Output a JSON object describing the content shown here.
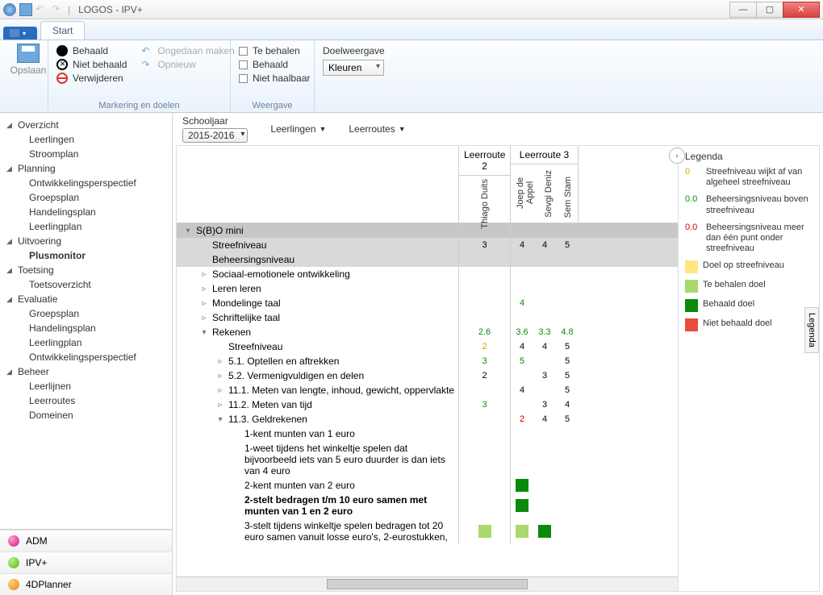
{
  "window": {
    "title": "LOGOS - IPV+"
  },
  "ribbon": {
    "tab": "Start",
    "save": "Opslaan",
    "mark": {
      "behaald": "Behaald",
      "niet_behaald": "Niet behaald",
      "verwijderen": "Verwijderen",
      "ongedaan": "Ongedaan maken",
      "opnieuw": "Opnieuw",
      "group": "Markering en doelen"
    },
    "weergave": {
      "te_behalen": "Te behalen",
      "behaald": "Behaald",
      "niet_haalbaar": "Niet haalbaar",
      "group": "Weergave"
    },
    "doel": {
      "label": "Doelweergave",
      "value": "Kleuren"
    }
  },
  "nav": {
    "groups": [
      {
        "label": "Overzicht",
        "items": [
          "Leerlingen",
          "Stroomplan"
        ]
      },
      {
        "label": "Planning",
        "items": [
          "Ontwikkelingsperspectief",
          "Groepsplan",
          "Handelingsplan",
          "Leerlingplan"
        ]
      },
      {
        "label": "Uitvoering",
        "items": [
          "Plusmonitor"
        ],
        "active": 0
      },
      {
        "label": "Toetsing",
        "items": [
          "Toetsoverzicht"
        ]
      },
      {
        "label": "Evaluatie",
        "items": [
          "Groepsplan",
          "Handelingsplan",
          "Leerlingplan",
          "Ontwikkelingsperspectief"
        ]
      },
      {
        "label": "Beheer",
        "items": [
          "Leerlijnen",
          "Leerroutes",
          "Domeinen"
        ]
      }
    ],
    "bottom": [
      "ADM",
      "IPV+",
      "4DPlanner"
    ]
  },
  "filter": {
    "schooljaar_label": "Schooljaar",
    "schooljaar": "2015-2016",
    "leerlingen": "Leerlingen",
    "leerroutes": "Leerroutes"
  },
  "grid": {
    "routes": [
      {
        "title": "Leerroute 2",
        "students": [
          "Thiago Duits"
        ]
      },
      {
        "title": "Leerroute 3",
        "students": [
          "Joep de Appel",
          "Sevgi Deniz",
          "Sem Stam"
        ]
      }
    ],
    "rows": [
      {
        "t": "hdr",
        "ind": 0,
        "tw": "▾",
        "label": "S(B)O mini"
      },
      {
        "t": "sub",
        "ind": 1,
        "label": "Streefniveau",
        "v": {
          "r2": "3",
          "r3": [
            "4",
            "4",
            "5"
          ]
        }
      },
      {
        "t": "sub",
        "ind": 1,
        "label": "Beheersingsniveau"
      },
      {
        "t": "row",
        "ind": 1,
        "tw": "▹",
        "label": "Sociaal-emotionele ontwikkeling"
      },
      {
        "t": "row",
        "ind": 1,
        "tw": "▹",
        "label": "Leren leren"
      },
      {
        "t": "row",
        "ind": 1,
        "tw": "▹",
        "label": "Mondelinge taal",
        "v": {
          "r3": [
            "4",
            "",
            ""
          ]
        },
        "cls": {
          "r3": [
            "green",
            "",
            ""
          ]
        }
      },
      {
        "t": "row",
        "ind": 1,
        "tw": "▹",
        "label": "Schriftelijke taal"
      },
      {
        "t": "row",
        "ind": 1,
        "tw": "▾",
        "label": "Rekenen",
        "v": {
          "r2": "2.6",
          "r3": [
            "3.6",
            "3.3",
            "4.8"
          ]
        },
        "cls": {
          "r2": "green",
          "r3": [
            "green",
            "green",
            "green"
          ]
        }
      },
      {
        "t": "row",
        "ind": 2,
        "label": "Streefniveau",
        "v": {
          "r2": "2",
          "r3": [
            "4",
            "4",
            "5"
          ]
        },
        "cls": {
          "r2": "orange"
        }
      },
      {
        "t": "row",
        "ind": 2,
        "tw": "▹",
        "label": "5.1. Optellen en aftrekken",
        "v": {
          "r2": "3",
          "r3": [
            "5",
            "",
            "5"
          ]
        },
        "cls": {
          "r2": "green",
          "r3": [
            "green",
            "",
            ""
          ]
        }
      },
      {
        "t": "row",
        "ind": 2,
        "tw": "▹",
        "label": "5.2. Vermenigvuldigen en delen",
        "v": {
          "r2": "2",
          "r3": [
            "",
            "3",
            "5"
          ]
        }
      },
      {
        "t": "row",
        "ind": 2,
        "tw": "▹",
        "label": "11.1. Meten van lengte, inhoud, gewicht, oppervlakte",
        "v": {
          "r3": [
            "4",
            "",
            "5"
          ]
        }
      },
      {
        "t": "row",
        "ind": 2,
        "tw": "▹",
        "label": "11.2. Meten van tijd",
        "v": {
          "r2": "3",
          "r3": [
            "",
            "3",
            "4"
          ]
        },
        "cls": {
          "r2": "green"
        }
      },
      {
        "t": "row",
        "ind": 2,
        "tw": "▾",
        "label": "11.3. Geldrekenen",
        "v": {
          "r3": [
            "2",
            "4",
            "5"
          ]
        },
        "cls": {
          "r3": [
            "red",
            "",
            ""
          ]
        }
      },
      {
        "t": "row",
        "ind": 3,
        "label": "1-kent munten van 1 euro"
      },
      {
        "t": "row",
        "ind": 3,
        "label": "1-weet tijdens het winkeltje spelen dat bijvoorbeeld iets van 5 euro duurder is dan iets van 4 euro"
      },
      {
        "t": "row",
        "ind": 3,
        "label": "2-kent munten van 2 euro",
        "blocks": {
          "r3": [
            "dg",
            "",
            ""
          ]
        }
      },
      {
        "t": "row",
        "ind": 3,
        "bold": true,
        "label": "2-stelt bedragen t/m 10 euro samen met munten van 1 en 2 euro",
        "blocks": {
          "r3": [
            "dg",
            "",
            ""
          ]
        }
      },
      {
        "t": "row",
        "ind": 3,
        "label": "3-stelt tijdens winkeltje spelen bedragen tot 20 euro samen vanuit losse euro's, 2-eurostukken,",
        "blocks": {
          "r2": "lg",
          "r3": [
            "lg",
            "dg",
            ""
          ]
        }
      }
    ]
  },
  "legend": {
    "title": "Legenda",
    "items_num": [
      {
        "key": "0",
        "cls": "o",
        "txt": "Streefniveau wijkt af van algeheel streefniveau"
      },
      {
        "key": "0.0",
        "cls": "g",
        "txt": "Beheersingsniveau boven streefniveau"
      },
      {
        "key": "0.0",
        "cls": "r",
        "txt": "Beheersingsniveau meer dan één punt onder streefniveau"
      }
    ],
    "items_sq": [
      {
        "cls": "y",
        "txt": "Doel op streefniveau"
      },
      {
        "cls": "lg",
        "txt": "Te behalen doel"
      },
      {
        "cls": "dg",
        "txt": "Behaald doel"
      },
      {
        "cls": "rd",
        "txt": "Niet behaald doel"
      }
    ],
    "tab": "Legenda"
  }
}
